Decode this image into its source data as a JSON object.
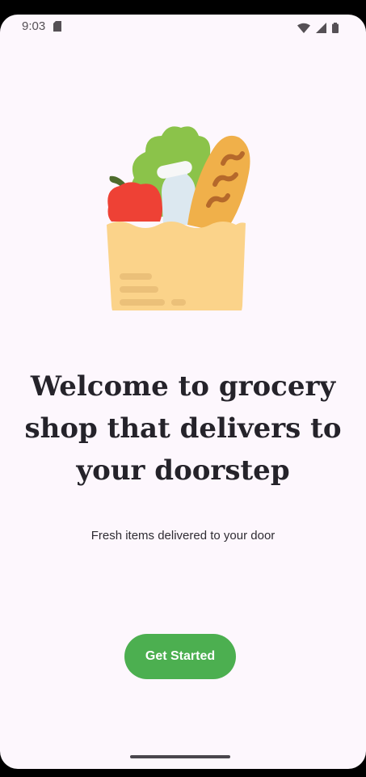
{
  "status_bar": {
    "time": "9:03",
    "icons": [
      "sd-card-icon",
      "wifi-icon",
      "signal-icon",
      "battery-icon"
    ]
  },
  "welcome": {
    "headline": "Welcome to grocery shop that delivers to your doorstep",
    "subtitle": "Fresh items delivered to your door",
    "cta_label": "Get Started"
  },
  "colors": {
    "background": "#fdf7fd",
    "accent": "#4caf50",
    "text": "#25232a"
  },
  "illustration": {
    "name": "grocery-bag-icon",
    "items": [
      "lettuce",
      "bell-pepper",
      "milk-bottle",
      "baguette"
    ]
  }
}
